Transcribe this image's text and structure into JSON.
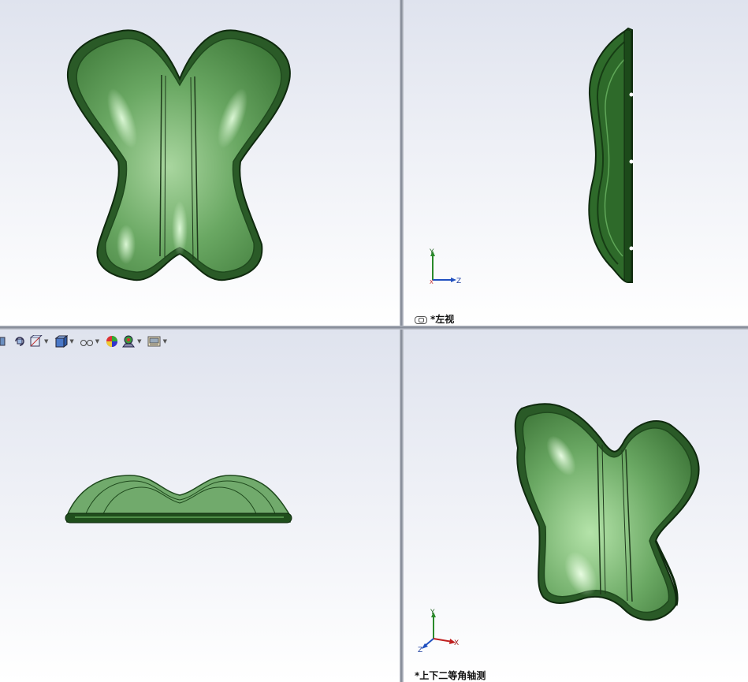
{
  "views": {
    "top_left": {
      "label": ""
    },
    "top_right": {
      "label": "*左视",
      "triad": {
        "up": "Y",
        "right": "Z"
      }
    },
    "bottom_left": {
      "label": ""
    },
    "bottom_right": {
      "label": "*上下二等角轴测",
      "triad": {
        "up": "Y",
        "right": "X",
        "front": "Z"
      }
    }
  },
  "toolbar": {
    "items": [
      {
        "icon": "zoom-icon"
      },
      {
        "icon": "rotate-view-icon"
      },
      {
        "icon": "section-view-icon"
      },
      {
        "icon": "display-style-icon"
      },
      {
        "icon": "hide-show-items-icon"
      },
      {
        "icon": "edit-appearance-icon"
      },
      {
        "icon": "apply-scene-icon"
      },
      {
        "icon": "view-settings-icon"
      }
    ]
  },
  "colors": {
    "part_fill": "#6aa863",
    "part_dark": "#1f4a1d",
    "part_edge": "#0f2a0e",
    "highlight": "#d8ffd0",
    "viewport_top": "#dfe3ee",
    "viewport_bottom": "#ffffff"
  }
}
